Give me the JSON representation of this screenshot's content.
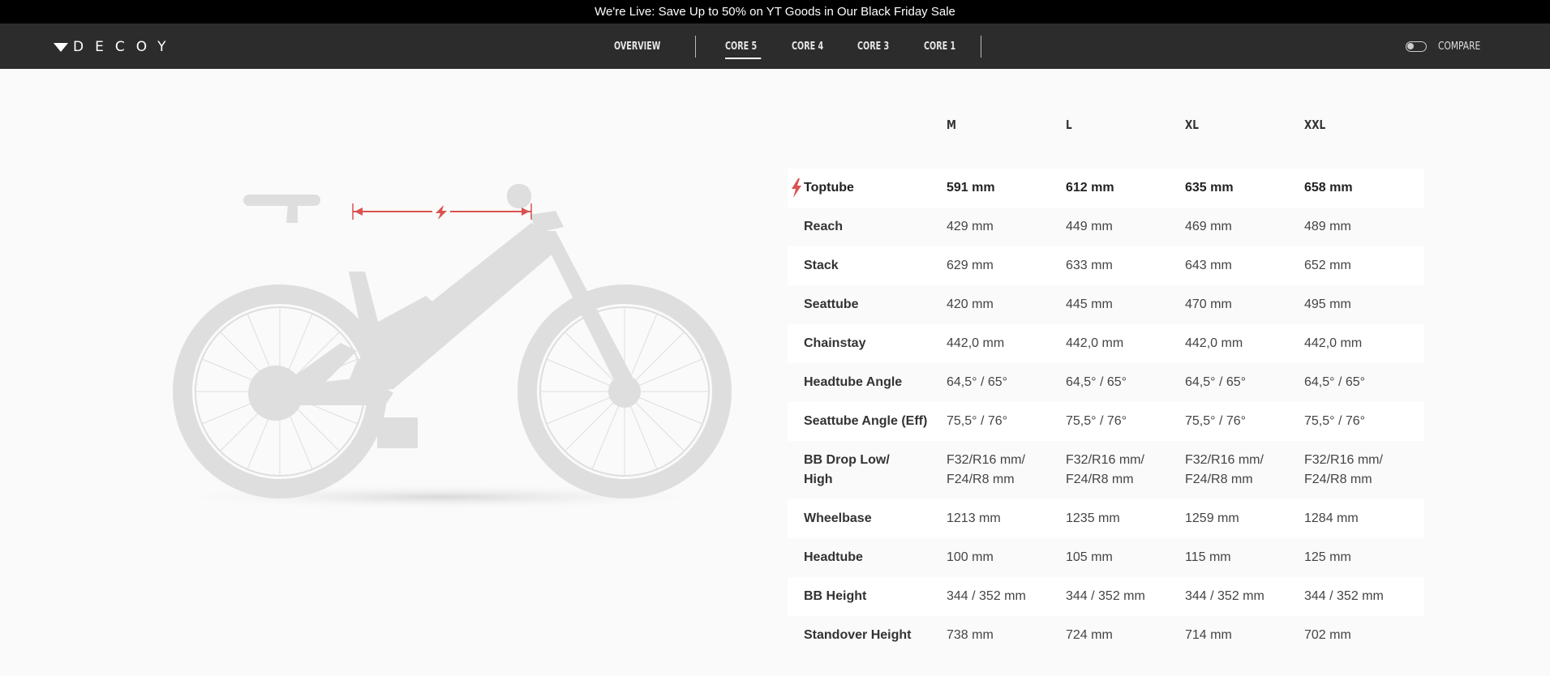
{
  "promo": {
    "text": "We're Live: Save Up to 50% on YT Goods in Our Black Friday Sale"
  },
  "brand": {
    "logo_text": "DECOY"
  },
  "nav": {
    "items": [
      {
        "label": "OVERVIEW",
        "active": false
      },
      {
        "label": "CORE 5",
        "active": true
      },
      {
        "label": "CORE 4",
        "active": false
      },
      {
        "label": "CORE 3",
        "active": false
      },
      {
        "label": "CORE 1",
        "active": false
      }
    ],
    "compare_label": "COMPARE",
    "compare_toggle": "off"
  },
  "colors": {
    "accent": "#d9534f",
    "navbar": "#2c2c2c",
    "promo_bar": "#000000",
    "bike": "#dedede"
  },
  "geometry": {
    "sizes": [
      "M",
      "L",
      "XL",
      "XXL"
    ],
    "rows": [
      {
        "label": "Toptube",
        "values": [
          "591 mm",
          "612 mm",
          "635 mm",
          "658 mm"
        ],
        "highlight": true
      },
      {
        "label": "Reach",
        "values": [
          "429 mm",
          "449 mm",
          "469 mm",
          "489 mm"
        ]
      },
      {
        "label": "Stack",
        "values": [
          "629 mm",
          "633 mm",
          "643 mm",
          "652 mm"
        ]
      },
      {
        "label": "Seattube",
        "values": [
          "420 mm",
          "445 mm",
          "470 mm",
          "495 mm"
        ]
      },
      {
        "label": "Chainstay",
        "values": [
          "442,0 mm",
          "442,0 mm",
          "442,0 mm",
          "442,0 mm"
        ]
      },
      {
        "label": "Headtube Angle",
        "values": [
          "64,5° / 65°",
          "64,5° / 65°",
          "64,5° / 65°",
          "64,5° / 65°"
        ]
      },
      {
        "label": "Seattube Angle (Eff)",
        "values": [
          "75,5° / 76°",
          "75,5° / 76°",
          "75,5° / 76°",
          "75,5° / 76°"
        ]
      },
      {
        "label": "BB Drop Low/ High",
        "values": [
          "F32/R16 mm/ F24/R8 mm",
          "F32/R16 mm/ F24/R8 mm",
          "F32/R16 mm/ F24/R8 mm",
          "F32/R16 mm/ F24/R8 mm"
        ]
      },
      {
        "label": "Wheelbase",
        "values": [
          "1213 mm",
          "1235 mm",
          "1259 mm",
          "1284 mm"
        ]
      },
      {
        "label": "Headtube",
        "values": [
          "100 mm",
          "105 mm",
          "115 mm",
          "125 mm"
        ]
      },
      {
        "label": "BB Height",
        "values": [
          "344 / 352 mm",
          "344 / 352 mm",
          "344 / 352 mm",
          "344 / 352 mm"
        ]
      },
      {
        "label": "Standover Height",
        "values": [
          "738 mm",
          "724 mm",
          "714 mm",
          "702 mm"
        ]
      }
    ]
  }
}
